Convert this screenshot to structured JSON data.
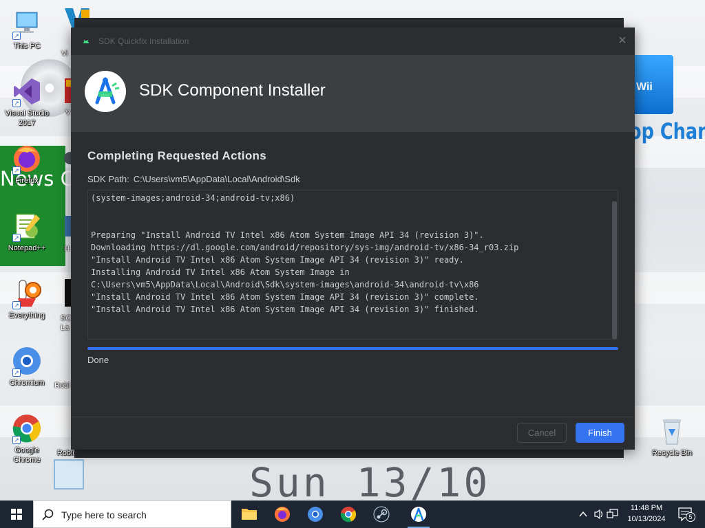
{
  "desktop": {
    "wallpaper_text": {
      "news": "News Ch",
      "shop": "op Channe",
      "shop_bag": "Wii",
      "date": "Sun 13/10"
    },
    "icons": [
      {
        "label": "This PC",
        "icon": "computer-icon"
      },
      {
        "label": "Visual Studio 2017",
        "icon": "visual-studio-icon"
      },
      {
        "label": "Firefox",
        "icon": "firefox-icon"
      },
      {
        "label": "Notepad++",
        "icon": "notepadpp-icon"
      },
      {
        "label": "Everything",
        "icon": "everything-icon"
      },
      {
        "label": "Chromium",
        "icon": "chromium-icon"
      },
      {
        "label": "Google Chrome",
        "icon": "chrome-icon"
      },
      {
        "label": "Roblox",
        "icon": "roblox-icon"
      },
      {
        "label": "Recycle Bin",
        "icon": "recycle-bin-icon"
      }
    ],
    "partial_labels": [
      "Vi",
      "V",
      "H",
      "SC",
      "La",
      "Robl"
    ]
  },
  "window": {
    "title": "SDK Quickfix Installation",
    "header_title": "SDK Component Installer",
    "section_title": "Completing Requested Actions",
    "sdk_path_label": "SDK Path:",
    "sdk_path_value": "C:\\Users\\vm5\\AppData\\Local\\Android\\Sdk",
    "log_lines": [
      "(system-images;android-34;android-tv;x86)",
      "",
      "",
      "Preparing \"Install Android TV Intel x86 Atom System Image API 34 (revision 3)\".",
      "Downloading https://dl.google.com/android/repository/sys-img/android-tv/x86-34_r03.zip",
      "\"Install Android TV Intel x86 Atom System Image API 34 (revision 3)\" ready.",
      "Installing Android TV Intel x86 Atom System Image in",
      "C:\\Users\\vm5\\AppData\\Local\\Android\\Sdk\\system-images\\android-34\\android-tv\\x86",
      "\"Install Android TV Intel x86 Atom System Image API 34 (revision 3)\" complete.",
      "\"Install Android TV Intel x86 Atom System Image API 34 (revision 3)\" finished."
    ],
    "progress_percent": 100,
    "status": "Done",
    "buttons": {
      "cancel": "Cancel",
      "finish": "Finish"
    },
    "colors": {
      "accent": "#3574f0",
      "header_bg": "#3c3f41",
      "body_bg": "#2b2d30"
    }
  },
  "taskbar": {
    "search_placeholder": "Type here to search",
    "apps": [
      "file-explorer-icon",
      "firefox-icon",
      "chromium-icon",
      "chrome-icon",
      "steam-icon",
      "android-studio-icon"
    ],
    "clock_time": "11:48 PM",
    "clock_date": "10/13/2024",
    "notification_count": "5"
  }
}
